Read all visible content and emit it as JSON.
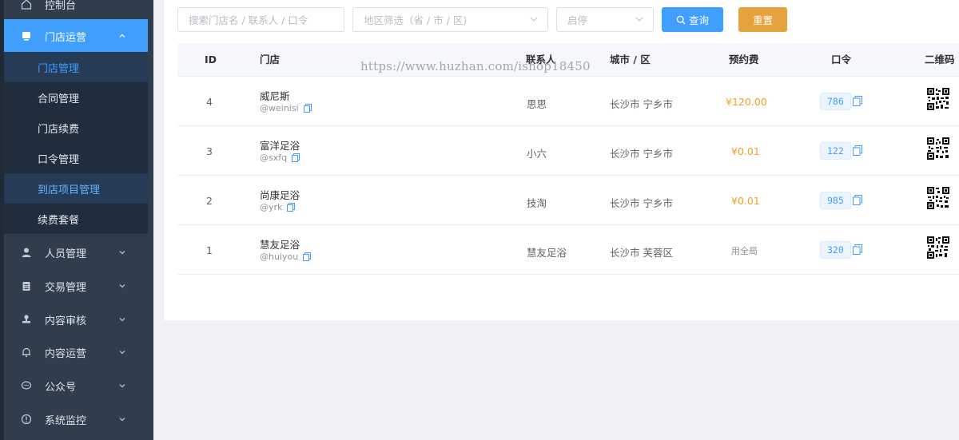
{
  "sidebar": {
    "items": [
      {
        "label": "控制台",
        "icon": "home-icon"
      },
      {
        "label": "门店运营",
        "icon": "store-icon",
        "expanded": true
      },
      {
        "label": "人员管理",
        "icon": "user-icon"
      },
      {
        "label": "交易管理",
        "icon": "clipboard-icon"
      },
      {
        "label": "内容审核",
        "icon": "stamp-icon"
      },
      {
        "label": "内容运营",
        "icon": "bell-icon"
      },
      {
        "label": "公众号",
        "icon": "chat-icon"
      },
      {
        "label": "系统监控",
        "icon": "info-icon"
      }
    ],
    "submenu": [
      {
        "label": "门店管理"
      },
      {
        "label": "合同管理"
      },
      {
        "label": "门店续费"
      },
      {
        "label": "口令管理"
      },
      {
        "label": "到店项目管理"
      },
      {
        "label": "续费套餐"
      }
    ]
  },
  "filters": {
    "search_placeholder": "搜索门店名 / 联系人 / 口令",
    "region_placeholder": "地区筛选（省 / 市 / 区)",
    "status_placeholder": "启停",
    "query_label": "查询",
    "reset_label": "重置"
  },
  "table": {
    "headers": {
      "id": "ID",
      "store": "门店",
      "contact": "联系人",
      "city": "城市 / 区",
      "fee": "预约费",
      "pin": "口令",
      "qr": "二维码"
    },
    "rows": [
      {
        "id": "4",
        "name": "威尼斯",
        "handle": "@weinisi",
        "contact": "思思",
        "city": "长沙市 宁乡市",
        "fee": "¥120.00",
        "pin": "786"
      },
      {
        "id": "3",
        "name": "富洋足浴",
        "handle": "@sxfq",
        "contact": "小六",
        "city": "长沙市 宁乡市",
        "fee": "¥0.01",
        "pin": "122"
      },
      {
        "id": "2",
        "name": "尚康足浴",
        "handle": "@yrk",
        "contact": "技淘",
        "city": "长沙市 宁乡市",
        "fee": "¥0.01",
        "pin": "985"
      },
      {
        "id": "1",
        "name": "慧友足浴",
        "handle": "@huiyou",
        "contact": "慧友足浴",
        "city": "长沙市 芙蓉区",
        "fee": "用全局",
        "pin": "320"
      }
    ]
  },
  "watermark": "https://www.huzhan.com/ishop18450",
  "colors": {
    "accent": "#409eff",
    "warning": "#e6a23c",
    "sidebar_bg": "#2f3d4c",
    "fee": "#f0a020"
  }
}
